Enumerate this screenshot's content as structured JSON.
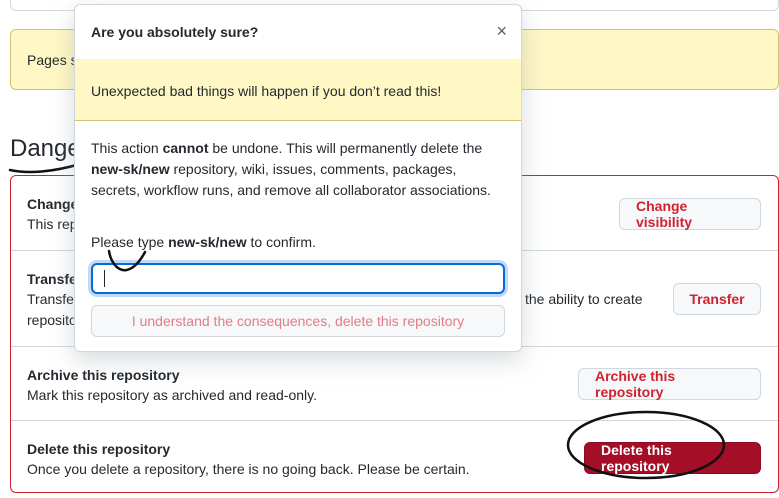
{
  "background": {
    "pages_notice_prefix": "Pages s",
    "danger_heading": "Dange",
    "rows": [
      {
        "title": "Change",
        "desc": "This rep",
        "button": "Change visibility"
      },
      {
        "title": "Transfe",
        "desc_line1": "Transfe",
        "desc_line1_tail": "the ability to create",
        "desc_line2": "reposito",
        "button": "Transfer"
      },
      {
        "title": "Archive this repository",
        "desc": "Mark this repository as archived and read-only.",
        "button": "Archive this repository"
      },
      {
        "title": "Delete this repository",
        "desc": "Once you delete a repository, there is no going back. Please be certain.",
        "button": "Delete this repository"
      }
    ]
  },
  "modal": {
    "title": "Are you absolutely sure?",
    "close_glyph": "×",
    "warning": "Unexpected bad things will happen if you don’t read this!",
    "body_pre": "This action ",
    "body_bold": "cannot",
    "body_mid": " be undone. This will permanently delete the ",
    "body_repo": "new-sk/new",
    "body_post": " repository, wiki, issues, comments, packages, secrets, workflow runs, and remove all collaborator associations.",
    "confirm_pre": "Please type ",
    "confirm_repo": "new-sk/new",
    "confirm_post": " to confirm.",
    "input_value": "",
    "confirm_button": "I understand the consequences, delete this repository"
  },
  "colors": {
    "danger": "#cf222e",
    "danger_solid": "#a40e26",
    "warning_bg": "#fff8c5",
    "focus": "#0969da"
  }
}
